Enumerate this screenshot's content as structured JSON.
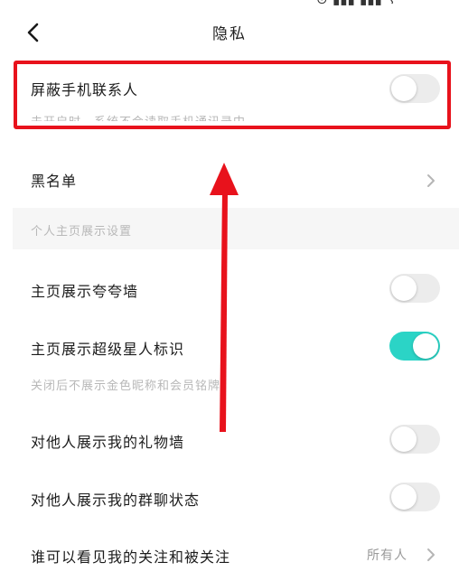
{
  "header": {
    "title": "隐私",
    "back_icon": "chevron-left-icon"
  },
  "rows": {
    "block_contacts": {
      "label": "屏蔽手机联系人",
      "hint": "未开启时，系统不会读取手机通讯录中",
      "enabled": false
    },
    "blacklist": {
      "label": "黑名单"
    },
    "section_title": "个人主页展示设置",
    "praise_wall": {
      "label": "主页展示夸夸墙",
      "enabled": false
    },
    "super_star": {
      "label": "主页展示超级星人标识",
      "enabled": true,
      "hint": "关闭后不展示金色昵称和会员铭牌"
    },
    "gift_wall": {
      "label": "对他人展示我的礼物墙",
      "enabled": false
    },
    "group_status": {
      "label": "对他人展示我的群聊状态",
      "enabled": false
    },
    "follow_visibility": {
      "label": "谁可以看见我的关注和被关注",
      "value": "所有人"
    }
  },
  "colors": {
    "toggle_on": "#2bd4c6",
    "toggle_off": "#ececec",
    "highlight": "#e8121c"
  }
}
